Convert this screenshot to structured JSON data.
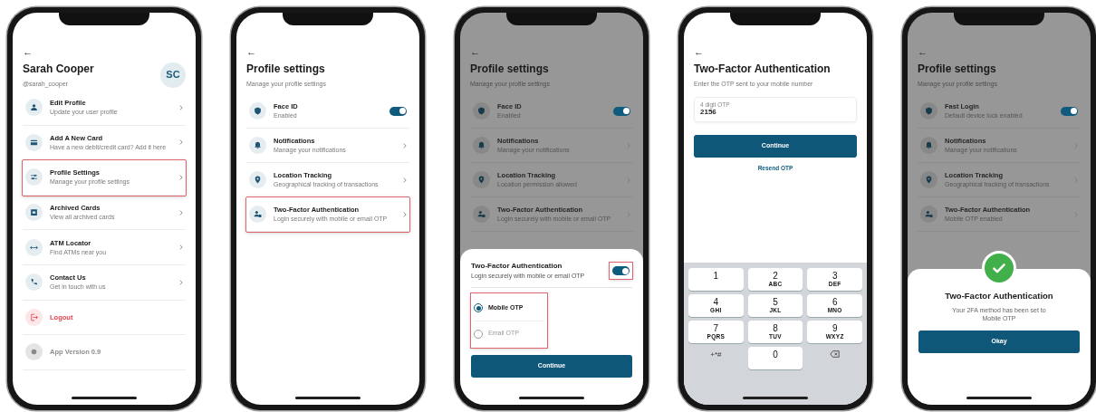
{
  "screens": [
    {
      "kind": "account",
      "back": "←",
      "name": "Sarah Cooper",
      "handle": "@sarah_cooper",
      "avatar": "SC",
      "items": [
        {
          "kind": "link",
          "title": "Edit Profile",
          "subtitle": "Update your user profile",
          "highlighted": false
        },
        {
          "kind": "link",
          "title": "Add A New Card",
          "subtitle": "Have a new debit/credit card? Add it here",
          "highlighted": false
        },
        {
          "kind": "link",
          "title": "Profile Settings",
          "subtitle": "Manage your profile settings",
          "highlighted": true
        },
        {
          "kind": "link",
          "title": "Archived Cards",
          "subtitle": "View all archived cards",
          "highlighted": false
        },
        {
          "kind": "link",
          "title": "ATM Locator",
          "subtitle": "Find ATMs near you",
          "highlighted": false
        },
        {
          "kind": "link",
          "title": "Contact Us",
          "subtitle": "Get in touch with us",
          "highlighted": false
        },
        {
          "kind": "danger",
          "title": "Logout",
          "highlighted": false
        },
        {
          "kind": "muted",
          "title": "App Version 0.9",
          "highlighted": false
        }
      ]
    },
    {
      "kind": "settings",
      "dimmed": false,
      "back": "←",
      "title": "Profile settings",
      "subtitle": "Manage your profile settings",
      "items": [
        {
          "kind": "toggle",
          "title": "Face ID",
          "subtitle": "Enabled",
          "on": true,
          "highlighted": false
        },
        {
          "kind": "link",
          "title": "Notifications",
          "subtitle": "Manage your notifications",
          "highlighted": false
        },
        {
          "kind": "link",
          "title": "Location Tracking",
          "subtitle": "Geographical tracking of transactions",
          "highlighted": false
        },
        {
          "kind": "link",
          "title": "Two-Factor Authentication",
          "subtitle": "Login securely with mobile or email OTP",
          "highlighted": true
        }
      ]
    },
    {
      "kind": "settings",
      "dimmed": true,
      "back": "←",
      "title": "Profile settings",
      "subtitle": "Manage your profile settings",
      "items": [
        {
          "kind": "toggle",
          "title": "Face ID",
          "subtitle": "Enabled",
          "on": true,
          "highlighted": false
        },
        {
          "kind": "link",
          "title": "Notifications",
          "subtitle": "Manage your notifications",
          "highlighted": false
        },
        {
          "kind": "link",
          "title": "Location Tracking",
          "subtitle": "Location permission allowed",
          "highlighted": false
        },
        {
          "kind": "link",
          "title": "Two-Factor Authentication",
          "subtitle": "Login securely with mobile or email OTP",
          "highlighted": false
        }
      ],
      "sheet": {
        "title": "Two-Factor Authentication",
        "subtitle": "Login securely with mobile or email OTP",
        "on": true,
        "toggle_highlighted": true,
        "options_highlighted": true,
        "options": [
          {
            "label": "Mobile OTP",
            "selected": true
          },
          {
            "label": "Email OTP",
            "selected": false
          }
        ],
        "button": "Continue"
      }
    },
    {
      "kind": "otp",
      "back": "←",
      "title": "Two-Factor Authentication",
      "subtitle": "Enter the OTP sent to your mobile number",
      "field": {
        "label": "4 digit OTP",
        "value": "2156"
      },
      "button": "Continue",
      "link": "Resend OTP",
      "keys": [
        {
          "kind": "digit",
          "digit": "1"
        },
        {
          "kind": "digit",
          "digit": "2",
          "letters": "ABC"
        },
        {
          "kind": "digit",
          "digit": "3",
          "letters": "DEF"
        },
        {
          "kind": "digit",
          "digit": "4",
          "letters": "GHI"
        },
        {
          "kind": "digit",
          "digit": "5",
          "letters": "JKL"
        },
        {
          "kind": "digit",
          "digit": "6",
          "letters": "MNO"
        },
        {
          "kind": "digit",
          "digit": "7",
          "letters": "PQRS"
        },
        {
          "kind": "digit",
          "digit": "8",
          "letters": "TUV"
        },
        {
          "kind": "digit",
          "digit": "9",
          "letters": "WXYZ"
        },
        {
          "kind": "symbols",
          "digit": "+*#"
        },
        {
          "kind": "digit",
          "digit": "0"
        },
        {
          "kind": "backspace"
        }
      ]
    },
    {
      "kind": "settings",
      "dimmed": true,
      "back": "←",
      "title": "Profile settings",
      "subtitle": "Manage your profile settings",
      "items": [
        {
          "kind": "toggle",
          "title": "Fast Login",
          "subtitle": "Default device lock enabled",
          "on": true,
          "highlighted": false
        },
        {
          "kind": "link",
          "title": "Notifications",
          "subtitle": "Manage your notifications",
          "highlighted": false
        },
        {
          "kind": "link",
          "title": "Location Tracking",
          "subtitle": "Geographical tracking of transactions",
          "highlighted": false
        },
        {
          "kind": "link",
          "title": "Two-Factor Authentication",
          "subtitle": "Mobile OTP enabled",
          "highlighted": false
        }
      ],
      "dialog": {
        "title": "Two-Factor Authentication",
        "message": "Your 2FA method has been set to Mobile OTP",
        "button": "Okay"
      }
    }
  ]
}
